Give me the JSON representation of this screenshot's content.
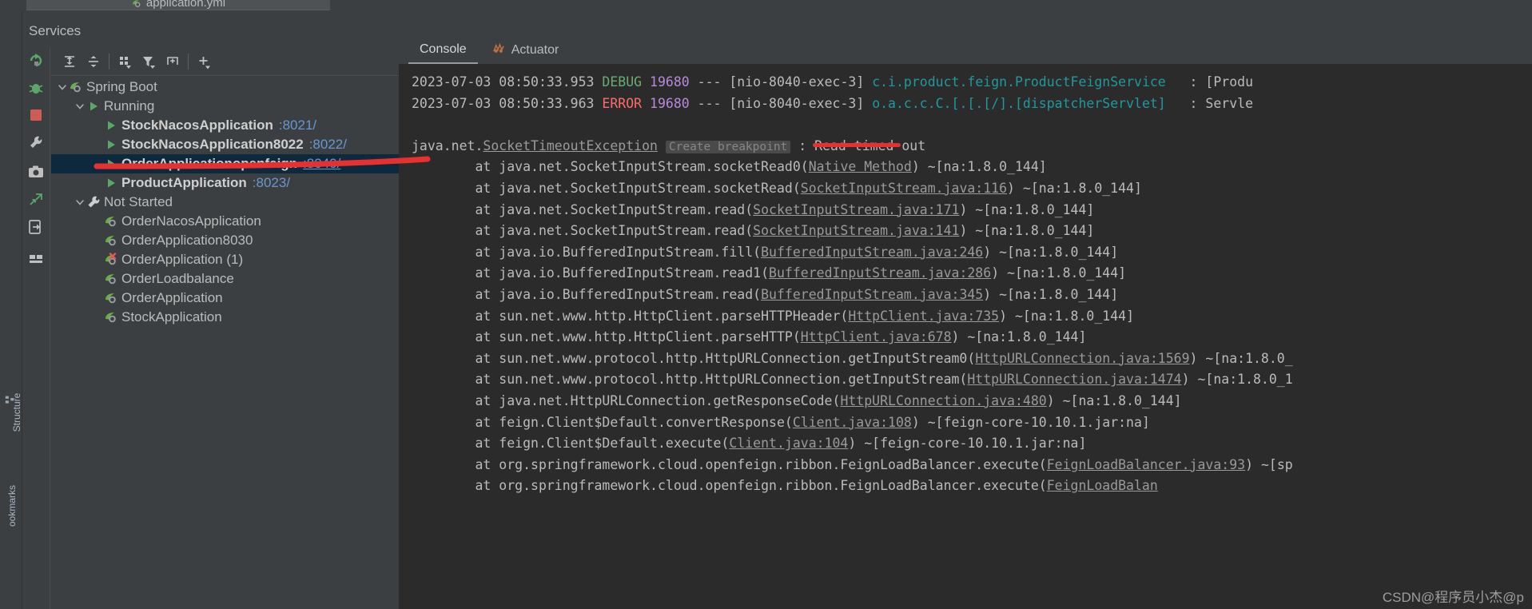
{
  "editor": {
    "tab_label": "application.yml",
    "tab_icon": "spring-yaml-icon"
  },
  "left_rail": {
    "structure_label": "Structure",
    "bookmarks_label": "ookmarks"
  },
  "services": {
    "title": "Services",
    "toolbar": [
      {
        "name": "rerun-icon",
        "label": "Rerun"
      },
      {
        "name": "expand-all-icon",
        "label": "Expand All"
      },
      {
        "name": "collapse-all-icon",
        "label": "Collapse All"
      },
      {
        "name": "group-by-icon",
        "label": "Group By"
      },
      {
        "name": "filter-icon",
        "label": "Filter"
      },
      {
        "name": "add-tab-icon",
        "label": "Add Tab"
      },
      {
        "name": "add-icon",
        "label": "Add Service"
      }
    ],
    "rail_icons": [
      {
        "name": "rerun-green-icon"
      },
      {
        "name": "debug-bug-icon"
      },
      {
        "name": "stop-red-icon"
      },
      {
        "name": "settings-wrench-icon"
      },
      {
        "name": "screenshot-camera-icon"
      },
      {
        "name": "export-thread-icon"
      },
      {
        "name": "exit-arrow-icon"
      },
      {
        "name": "layout-grid-icon"
      }
    ],
    "tree": [
      {
        "label": "Spring Boot",
        "icon": "spring-leaf-icon",
        "indent": 0,
        "chevron": "down",
        "bold": false,
        "port": "",
        "selected": false,
        "port_link": false
      },
      {
        "label": "Running",
        "icon": "run-green-triangle-icon",
        "indent": 1,
        "chevron": "down",
        "bold": false,
        "port": "",
        "selected": false,
        "port_link": false
      },
      {
        "label": "StockNacosApplication",
        "icon": "run-green-triangle-icon",
        "indent": 2,
        "chevron": "none",
        "bold": true,
        "port": ":8021/",
        "selected": false,
        "port_link": false
      },
      {
        "label": "StockNacosApplication8022",
        "icon": "run-green-triangle-icon",
        "indent": 2,
        "chevron": "none",
        "bold": true,
        "port": ":8022/",
        "selected": false,
        "port_link": false
      },
      {
        "label": "OrderApplicationopenfeign",
        "icon": "run-green-triangle-icon",
        "indent": 2,
        "chevron": "none",
        "bold": true,
        "port": ":8040/",
        "selected": true,
        "port_link": true
      },
      {
        "label": "ProductApplication",
        "icon": "run-green-triangle-icon",
        "indent": 2,
        "chevron": "none",
        "bold": true,
        "port": ":8023/",
        "selected": false,
        "port_link": false
      },
      {
        "label": "Not Started",
        "icon": "wrench-icon",
        "indent": 1,
        "chevron": "down",
        "bold": false,
        "port": "",
        "selected": false,
        "port_link": false
      },
      {
        "label": "OrderNacosApplication",
        "icon": "spring-leaf-icon",
        "indent": 2,
        "chevron": "none",
        "bold": false,
        "port": "",
        "selected": false,
        "port_link": false
      },
      {
        "label": "OrderApplication8030",
        "icon": "spring-leaf-icon",
        "indent": 2,
        "chevron": "none",
        "bold": false,
        "port": "",
        "selected": false,
        "port_link": false
      },
      {
        "label": "OrderApplication (1)",
        "icon": "spring-leaf-error-icon",
        "indent": 2,
        "chevron": "none",
        "bold": false,
        "port": "",
        "selected": false,
        "port_link": false
      },
      {
        "label": "OrderLoadbalance",
        "icon": "spring-leaf-icon",
        "indent": 2,
        "chevron": "none",
        "bold": false,
        "port": "",
        "selected": false,
        "port_link": false
      },
      {
        "label": "OrderApplication",
        "icon": "spring-leaf-icon",
        "indent": 2,
        "chevron": "none",
        "bold": false,
        "port": "",
        "selected": false,
        "port_link": false
      },
      {
        "label": "StockApplication",
        "icon": "spring-leaf-icon",
        "indent": 2,
        "chevron": "none",
        "bold": false,
        "port": "",
        "selected": false,
        "port_link": false
      }
    ]
  },
  "console_panel": {
    "tabs": [
      {
        "label": "Console",
        "icon": "",
        "active": true
      },
      {
        "label": "Actuator",
        "icon": "actuator-icon",
        "active": false
      }
    ],
    "log": {
      "line1": {
        "date": "2023-07-03 08:50:33.953 ",
        "level": "DEBUG",
        "pid": " 19680",
        "dash": " --- ",
        "thread": "[nio-8040-exec-3] ",
        "logger": "c.i.product.feign.ProductFeignService",
        "sep": "   : ",
        "msg": "[Produ"
      },
      "line2": {
        "date": "2023-07-03 08:50:33.963 ",
        "level": "ERROR",
        "pid": " 19680",
        "dash": " --- ",
        "thread": "[nio-8040-exec-3] ",
        "logger": "o.a.c.c.C.[.[.[/].[dispatcherServlet]",
        "sep": "   : ",
        "msg": "Servle"
      },
      "exception": {
        "prefix": "java.net.",
        "type": "SocketTimeoutException",
        "breakpoint_label": "Create breakpoint",
        "message": " : Read timed out"
      },
      "stack": [
        {
          "at": "        at java.net.SocketInputStream.socketRead0(",
          "link": "Native Method",
          "tail": ") ~[na:1.8.0_144]"
        },
        {
          "at": "        at java.net.SocketInputStream.socketRead(",
          "link": "SocketInputStream.java:116",
          "tail": ") ~[na:1.8.0_144]"
        },
        {
          "at": "        at java.net.SocketInputStream.read(",
          "link": "SocketInputStream.java:171",
          "tail": ") ~[na:1.8.0_144]"
        },
        {
          "at": "        at java.net.SocketInputStream.read(",
          "link": "SocketInputStream.java:141",
          "tail": ") ~[na:1.8.0_144]"
        },
        {
          "at": "        at java.io.BufferedInputStream.fill(",
          "link": "BufferedInputStream.java:246",
          "tail": ") ~[na:1.8.0_144]"
        },
        {
          "at": "        at java.io.BufferedInputStream.read1(",
          "link": "BufferedInputStream.java:286",
          "tail": ") ~[na:1.8.0_144]"
        },
        {
          "at": "        at java.io.BufferedInputStream.read(",
          "link": "BufferedInputStream.java:345",
          "tail": ") ~[na:1.8.0_144]"
        },
        {
          "at": "        at sun.net.www.http.HttpClient.parseHTTPHeader(",
          "link": "HttpClient.java:735",
          "tail": ") ~[na:1.8.0_144]"
        },
        {
          "at": "        at sun.net.www.http.HttpClient.parseHTTP(",
          "link": "HttpClient.java:678",
          "tail": ") ~[na:1.8.0_144]"
        },
        {
          "at": "        at sun.net.www.protocol.http.HttpURLConnection.getInputStream0(",
          "link": "HttpURLConnection.java:1569",
          "tail": ") ~[na:1.8.0_"
        },
        {
          "at": "        at sun.net.www.protocol.http.HttpURLConnection.getInputStream(",
          "link": "HttpURLConnection.java:1474",
          "tail": ") ~[na:1.8.0_1"
        },
        {
          "at": "        at java.net.HttpURLConnection.getResponseCode(",
          "link": "HttpURLConnection.java:480",
          "tail": ") ~[na:1.8.0_144]"
        },
        {
          "at": "        at feign.Client$Default.convertResponse(",
          "link": "Client.java:108",
          "tail": ") ~[feign-core-10.10.1.jar:na]"
        },
        {
          "at": "        at feign.Client$Default.execute(",
          "link": "Client.java:104",
          "tail": ") ~[feign-core-10.10.1.jar:na]"
        },
        {
          "at": "        at org.springframework.cloud.openfeign.ribbon.FeignLoadBalancer.execute(",
          "link": "FeignLoadBalancer.java:93",
          "tail": ") ~[sp"
        },
        {
          "at": "        at org.springframework.cloud.openfeign.ribbon.FeignLoadBalancer.execute(",
          "link": "FeignLoadBalan",
          "tail": ""
        }
      ]
    }
  },
  "watermark": "CSDN@程序员小杰@p",
  "colors": {
    "accent_red": "#e83030",
    "link_blue": "#6897cf",
    "selection": "#0d293e",
    "debug_green": "#6aab73",
    "error_red": "#ff6b68",
    "logger_teal": "#20999d",
    "pid_purple": "#b889dd",
    "console_bg": "#2b2b2b",
    "panel_bg": "#3c3f41"
  }
}
